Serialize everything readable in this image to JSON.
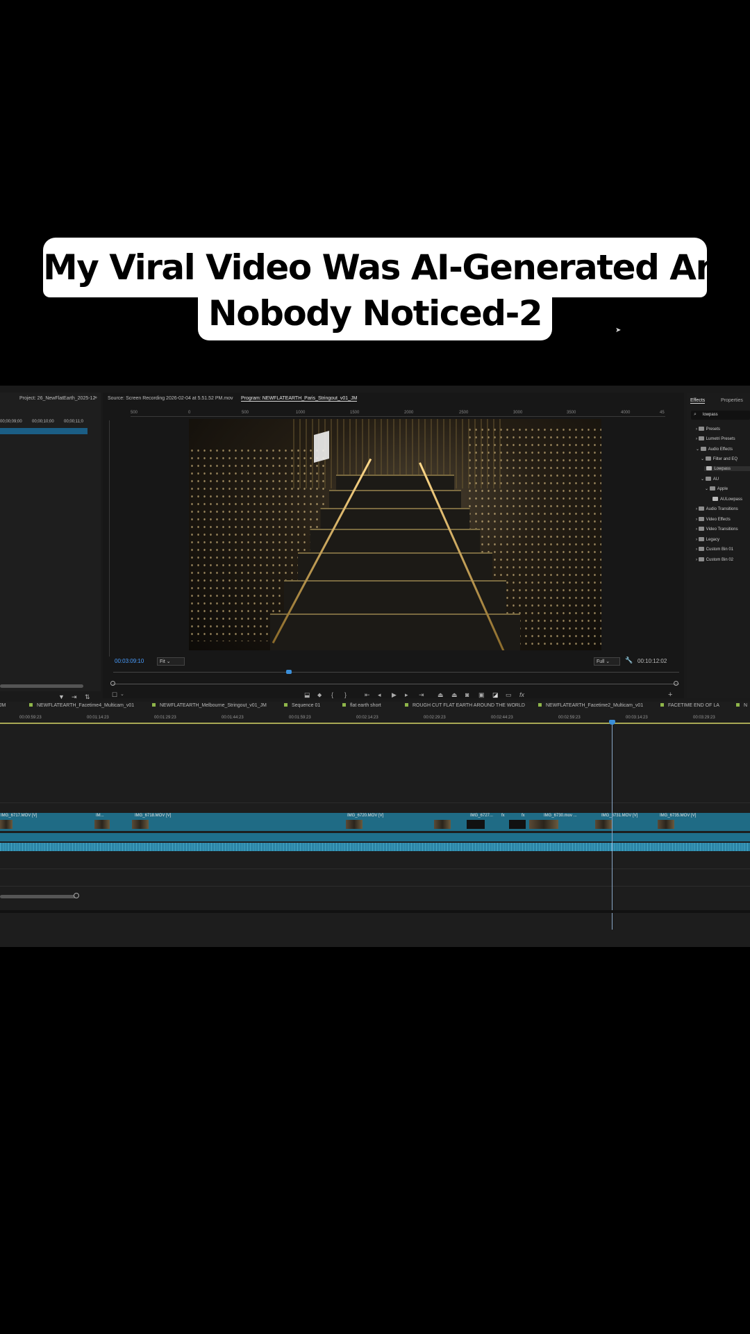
{
  "caption": {
    "line1": "My Viral Video Was AI-Generated And",
    "line2": "Nobody Noticed-2"
  },
  "project": {
    "title": "Project: 26_NewFlatEarth_2025-12",
    "timecodes": [
      "00;00;09;00",
      "00;00;10;00",
      "00;00;11;0"
    ]
  },
  "monitor": {
    "source_tab": "Source: Screen Recording 2026-02-04 at 5.51.52 PM.mov",
    "program_tab": "Program: NEWFLATEARTH_Paris_Stringout_v01_JM",
    "ruler_labels": [
      "500",
      "0",
      "500",
      "1000",
      "1500",
      "2000",
      "2500",
      "3000",
      "3500",
      "4000",
      "45"
    ],
    "timecode_current": "00:03:09:10",
    "fit": "Fit",
    "quality": "Full",
    "timecode_duration": "00:10:12:02"
  },
  "effects": {
    "tab_effects": "Effects",
    "tab_properties": "Properties",
    "search_value": "lowpass",
    "items": [
      {
        "label": "Presets",
        "level": 0
      },
      {
        "label": "Lumetri Presets",
        "level": 0
      },
      {
        "label": "Audio Effects",
        "level": 0
      },
      {
        "label": "Filter and EQ",
        "level": 1
      },
      {
        "label": "Lowpass",
        "level": 2
      },
      {
        "label": "AU",
        "level": 1
      },
      {
        "label": "Apple",
        "level": 2
      },
      {
        "label": "AULowpass",
        "level": 3
      },
      {
        "label": "Audio Transitions",
        "level": 0
      },
      {
        "label": "Video Effects",
        "level": 0
      },
      {
        "label": "Video Transitions",
        "level": 0
      },
      {
        "label": "Legacy",
        "level": 0
      },
      {
        "label": "Custom Bin 01",
        "level": 0
      },
      {
        "label": "Custom Bin 02",
        "level": 0
      }
    ]
  },
  "timeline": {
    "sequence_tabs": [
      "JM",
      "NEWFLATEARTH_Facetime4_Multicam_v01",
      "NEWFLATEARTH_Melbourne_Stringout_v01_JM",
      "Sequence 01",
      "flat earth short",
      "ROUGH CUT FLAT EARTH AROUND THE WORLD",
      "NEWFLATEARTH_Facetime2_Multicam_v01",
      "FACETIME END OF LA",
      "N"
    ],
    "timecodes": [
      "00:00:59:23",
      "00:01:14:23",
      "00:01:29:23",
      "00:01:44:23",
      "00:01:59:23",
      "00:02:14:23",
      "00:02:29:23",
      "00:02:44:23",
      "00:02:59:23",
      "00:03:14:23",
      "00:03:29:23"
    ],
    "clips": [
      "IMG_6717.MOV [V]",
      "IM...",
      "IMG_6718.MOV [V]",
      "IMG_6720.MOV [V]",
      "IMG_6727...",
      "fx",
      "fx",
      "IMG_6730.mov ...",
      "IMG_6731.MOV [V]",
      "IMG_6735.MOV [V]"
    ]
  },
  "colors": {
    "accent_blue": "#4a9eff",
    "clip_teal": "#1f6b85",
    "selection_blue": "#1b5e85"
  }
}
